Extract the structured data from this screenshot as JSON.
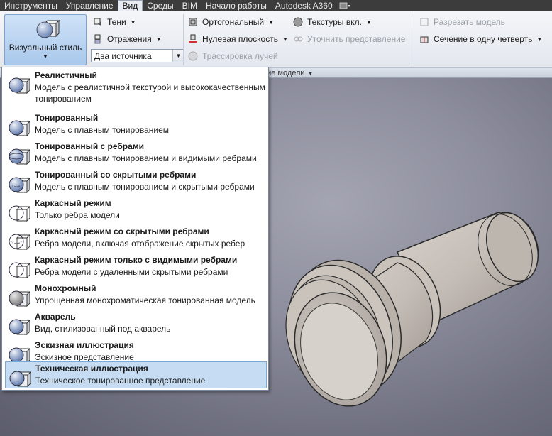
{
  "menubar": {
    "items": [
      "Инструменты",
      "Управление",
      "Вид",
      "Среды",
      "BIM",
      "Начало работы",
      "Autodesk A360"
    ],
    "active_index": 2
  },
  "ribbon": {
    "visual_style_label": "Визуальный стиль",
    "shadows": "Тени",
    "reflections": "Отражения",
    "lights_combo": "Два источника",
    "orthographic": "Ортогональный",
    "ground_plane": "Нулевая плоскость",
    "ray_tracing": "Трассировка лучей",
    "textures": "Текстуры вкл.",
    "refine_view": "Уточнить представление",
    "section_model": "Разрезать модель",
    "quarter_section": "Сечение в одну четверть",
    "panel_label": "ние модели"
  },
  "styles": [
    {
      "title": "Реалистичный",
      "desc": "Модель с реалистичной текстурой и высококачественным тонированием",
      "icon": "realistic-sphere-icon"
    },
    {
      "title": "Тонированный",
      "desc": "Модель с плавным тонированием",
      "icon": "shaded-sphere-icon"
    },
    {
      "title": "Тонированный с ребрами",
      "desc": "Модель с плавным тонированием и видимыми ребрами",
      "icon": "shaded-edges-icon"
    },
    {
      "title": "Тонированный со скрытыми ребрами",
      "desc": "Модель с плавным тонированием и скрытыми ребрами",
      "icon": "shaded-hidden-edges-icon"
    },
    {
      "title": "Каркасный режим",
      "desc": "Только ребра модели",
      "icon": "wireframe-icon"
    },
    {
      "title": "Каркасный режим со скрытыми ребрами",
      "desc": "Ребра модели, включая отображение скрытых ребер",
      "icon": "wireframe-hidden-icon"
    },
    {
      "title": "Каркасный режим только с видимыми ребрами",
      "desc": "Ребра модели с удаленными скрытыми ребрами",
      "icon": "wireframe-visible-icon"
    },
    {
      "title": "Монохромный",
      "desc": "Упрощенная монохроматическая тонированная модель",
      "icon": "monochrome-icon"
    },
    {
      "title": "Акварель",
      "desc": "Вид, стилизованный под акварель",
      "icon": "watercolor-icon"
    },
    {
      "title": "Эскизная иллюстрация",
      "desc": "Эскизное представление",
      "icon": "sketch-icon"
    },
    {
      "title": "Техническая иллюстрация",
      "desc": "Техническое тонированное представление",
      "icon": "technical-icon"
    }
  ],
  "selected_index": 10,
  "colors": {
    "accent": "#c6dcf2",
    "menubar": "#3c3c3c",
    "viewport": "#8e8f9e"
  }
}
